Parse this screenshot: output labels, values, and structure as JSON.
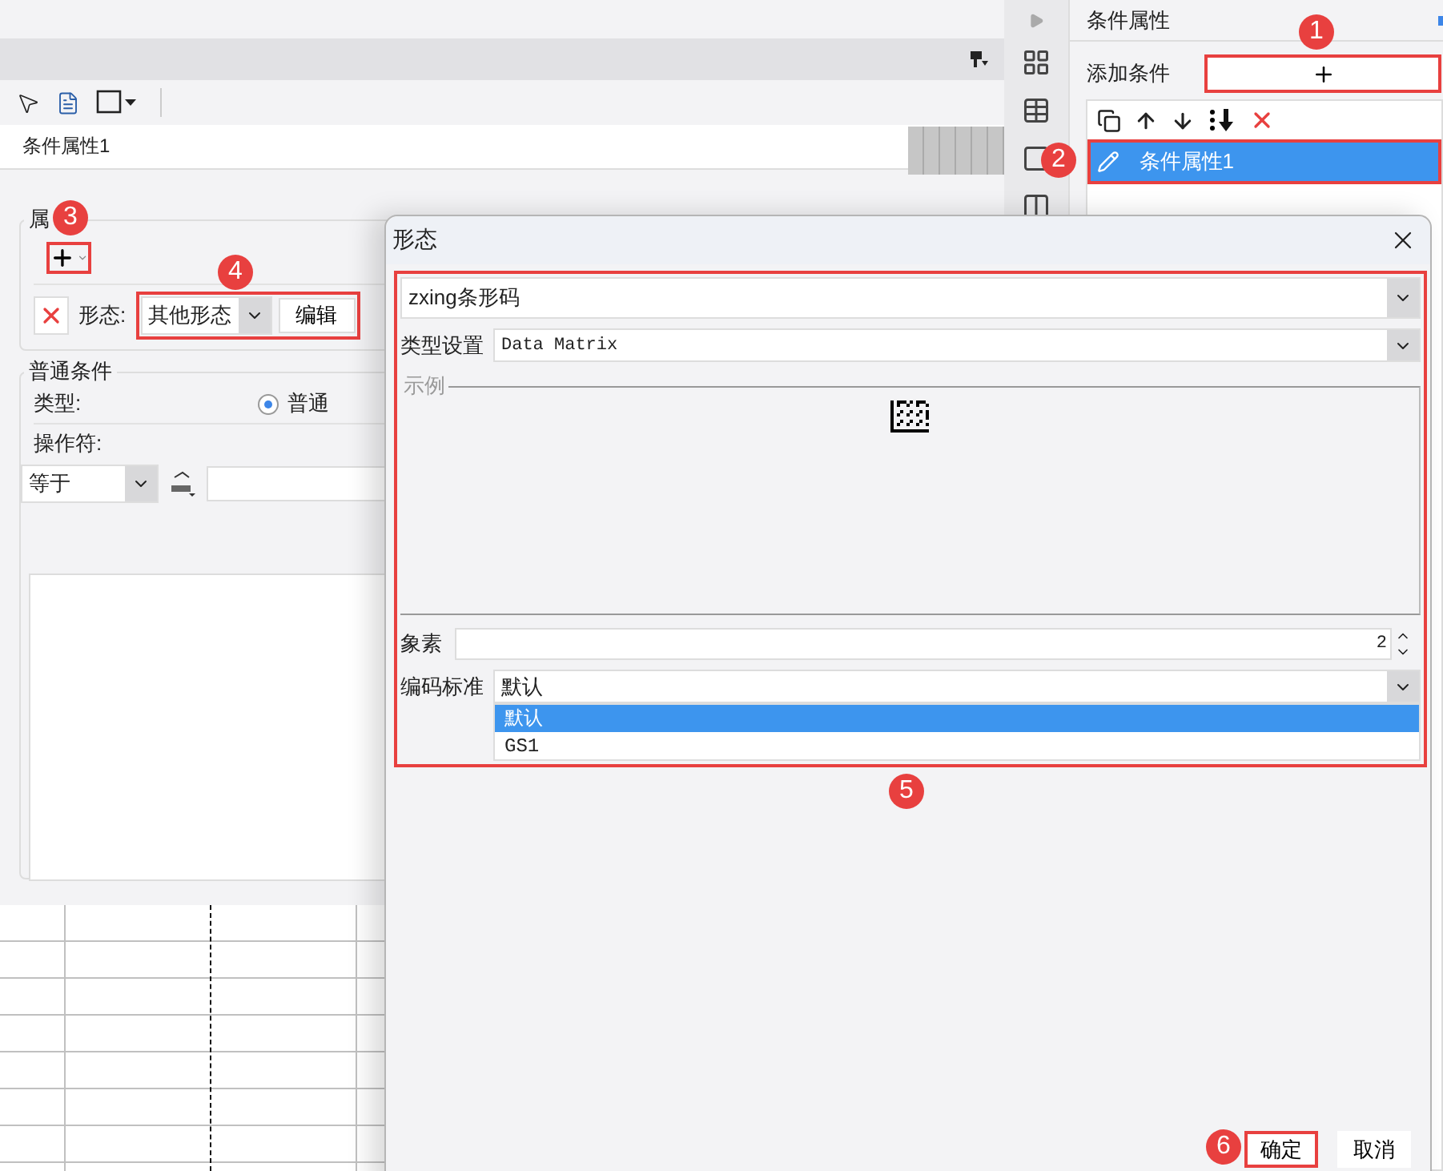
{
  "tab": {
    "label": "条件属性1"
  },
  "property_group": {
    "title": "属",
    "add_highlighted": true,
    "shape_label": "形态:",
    "shape_value": "其他形态",
    "edit_button": "编辑",
    "shape_highlighted": true
  },
  "condition_group": {
    "title": "普通条件",
    "type_label": "类型:",
    "type_options": [
      {
        "label": "普通",
        "selected": true
      }
    ],
    "operator_label": "操作符:",
    "operator_value": "等于"
  },
  "side_panel": {
    "title": "条件属性",
    "add_label": "添加条件",
    "add_highlighted": true,
    "items": [
      {
        "label": "条件属性1",
        "selected": true,
        "highlighted": true
      }
    ]
  },
  "dialog": {
    "title": "形态",
    "renderer": "zxing条形码",
    "type_label": "类型设置",
    "type_value": "Data Matrix",
    "preview_legend": "示例",
    "pixel_label": "象素",
    "pixel_value": "2",
    "encoding_label": "编码标准",
    "encoding_value": "默认",
    "form_highlighted": true,
    "encoding_options": [
      {
        "label": "默认",
        "selected": true
      },
      {
        "label": "GS1",
        "selected": false
      }
    ],
    "buttons": [
      {
        "label": "确定",
        "highlighted": true
      },
      {
        "label": "取消",
        "highlighted": false
      }
    ]
  },
  "callouts": [
    "1",
    "2",
    "3",
    "4",
    "5",
    "6"
  ]
}
